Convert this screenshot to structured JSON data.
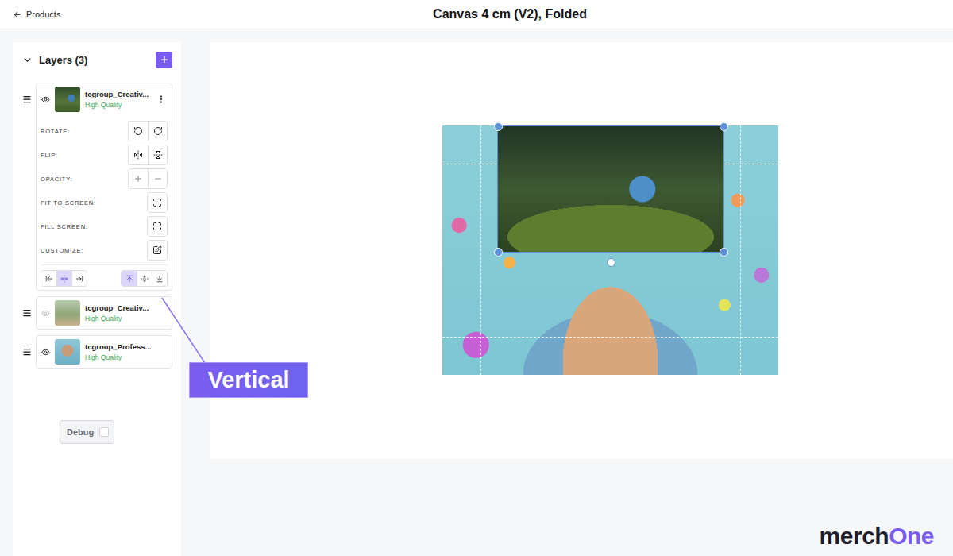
{
  "header": {
    "back_label": "Products",
    "title": "Canvas 4 cm (V2), Folded"
  },
  "layers_panel": {
    "title": "Layers (3)",
    "expanded": true,
    "layers": [
      {
        "name": "tcgroup_Creativ...",
        "quality": "High Quality",
        "visible": true,
        "expanded": true,
        "selected": true
      },
      {
        "name": "tcgroup_Creativ...",
        "quality": "High Quality",
        "visible": false,
        "expanded": false,
        "selected": false
      },
      {
        "name": "tcgroup_Profess...",
        "quality": "High Quality",
        "visible": true,
        "expanded": false,
        "selected": false
      }
    ],
    "controls": [
      {
        "label": "ROTATE:",
        "kind": "pair"
      },
      {
        "label": "FLIP:",
        "kind": "pair"
      },
      {
        "label": "OPACITY:",
        "kind": "pair"
      },
      {
        "label": "FIT TO SCREEN:",
        "kind": "single"
      },
      {
        "label": "FILL SCREEN:",
        "kind": "single"
      },
      {
        "label": "CUSTOMIZE:",
        "kind": "single"
      }
    ],
    "horizontal_align": [
      {
        "selected": false
      },
      {
        "selected": true
      },
      {
        "selected": false
      }
    ],
    "vertical_align": [
      {
        "selected": true
      },
      {
        "selected": false
      },
      {
        "selected": false
      }
    ]
  },
  "debug": {
    "label": "Debug",
    "checked": false
  },
  "annotation": {
    "label": "Vertical"
  },
  "logo": [
    {
      "text": "merch",
      "color": "#1f1d2b"
    },
    {
      "text": "One",
      "color": "#7b5cf0"
    }
  ]
}
